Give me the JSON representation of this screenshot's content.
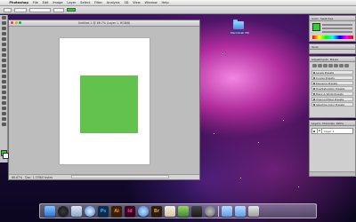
{
  "menubar": {
    "apple": "",
    "items": [
      "Photoshop",
      "File",
      "Edit",
      "Image",
      "Layer",
      "Select",
      "Filter",
      "Analysis",
      "3D",
      "View",
      "Window",
      "Help"
    ],
    "status": [
      "",
      "",
      ""
    ]
  },
  "document": {
    "title": "Untitled-1 @ 66.7% (Layer 1, RGB/8)",
    "zoom": "66.67%",
    "doc_info": "Doc: 1.37M/0 bytes"
  },
  "desktop": {
    "folder_label": "Macintosh HD"
  },
  "panels": {
    "color_tabs": [
      "Color",
      "Swatches"
    ],
    "tool_tabs": [
      "Tools"
    ],
    "adjustments_tabs": [
      "Adjustments",
      "Masks"
    ],
    "adjustments_presets": [
      "Levels Presets",
      "Curves Presets",
      "Exposure Presets",
      "Hue/Saturation Presets",
      "Black & White Presets",
      "Channel Mixer Presets",
      "Selective Color Presets"
    ],
    "layers_tabs": [
      "Layers",
      "Channels",
      "Paths"
    ],
    "layer_name": "Layer 1"
  },
  "colors": {
    "foreground": "#2ecc2e",
    "canvas_shape": "#63c24e"
  },
  "dock": {
    "apps": [
      "Finder",
      "Dashboard",
      "Mail",
      "Safari",
      "Photoshop",
      "Illustrator",
      "InDesign",
      "iTunes",
      "Bridge",
      "Preview",
      "iPhoto",
      "Camera",
      "System Preferences",
      "Folder",
      "Downloads",
      "Trash"
    ]
  }
}
